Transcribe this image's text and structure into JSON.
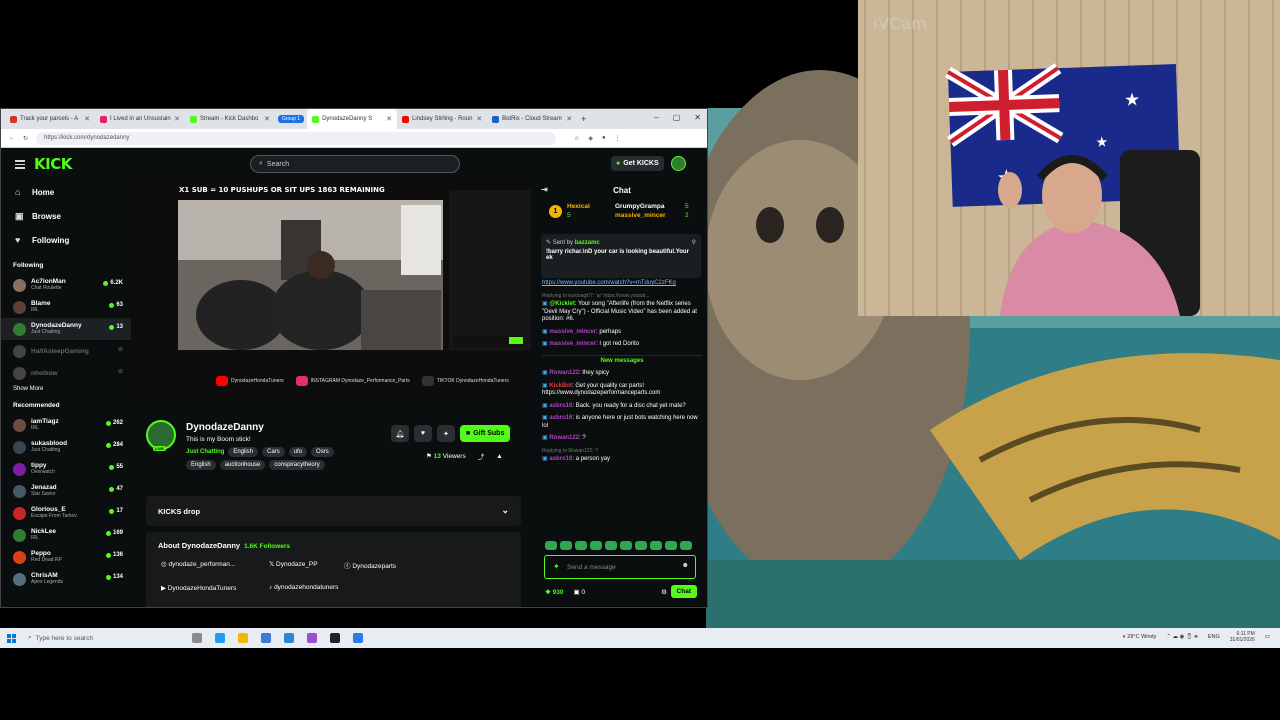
{
  "overlay": {
    "watermark": "iVCam"
  },
  "browser": {
    "tabs": [
      {
        "label": "Track your parcels - A",
        "color": "#d93025"
      },
      {
        "label": "I Lived in an Unsustain",
        "color": "#e91e63"
      },
      {
        "label": "Stream - Kick Dashbo",
        "color": "#53fc18"
      },
      {
        "label": "DynodazeDanny S",
        "color": "#53fc18",
        "active": true
      },
      {
        "label": "Lindsey Stirling - Roun",
        "color": "#ff0000"
      },
      {
        "label": "BotRix - Cloud Stream",
        "color": "#1565c0"
      }
    ],
    "group_label": "Group 1",
    "url": "https://kick.com/dynodazedanny",
    "addr_icons": [
      "↺",
      "☆",
      "⋮"
    ]
  },
  "kick": {
    "logo": "KICK",
    "search_placeholder": "Search",
    "get_kicks": "Get KICKS",
    "nav": [
      {
        "label": "Home",
        "icon": "home-icon",
        "glyph": "⌂"
      },
      {
        "label": "Browse",
        "icon": "browse-icon",
        "glyph": "▣"
      },
      {
        "label": "Following",
        "icon": "heart-icon",
        "glyph": "♥"
      }
    ],
    "following_label": "Following",
    "following": [
      {
        "name": "Ac7ionMan",
        "cat": "Chat Roulette",
        "viewers": "6.2K",
        "color": "#8d6e63"
      },
      {
        "name": "Blame",
        "cat": "IRL",
        "viewers": "63",
        "color": "#5d4037"
      },
      {
        "name": "DynodazeDanny",
        "cat": "Just Chatting",
        "viewers": "13",
        "color": "#2e7d32",
        "active": true
      },
      {
        "name": "HalfAsleepGaming",
        "cat": "",
        "viewers": "",
        "color": "#444",
        "off": true
      },
      {
        "name": "nhotkow",
        "cat": "",
        "viewers": "",
        "color": "#444",
        "off": true
      }
    ],
    "show_more": "Show More",
    "recommended_label": "Recommended",
    "recommended": [
      {
        "name": "iamTiagz",
        "cat": "IRL",
        "viewers": "262",
        "color": "#6d4c41"
      },
      {
        "name": "sukasblood",
        "cat": "Just Chatting",
        "viewers": "284",
        "color": "#37474f"
      },
      {
        "name": "tippy",
        "cat": "Overwatch",
        "viewers": "55",
        "color": "#7b1fa2"
      },
      {
        "name": "Jenazad",
        "cat": "Star Savior",
        "viewers": "47",
        "color": "#455a64"
      },
      {
        "name": "Glorious_E",
        "cat": "Escape From Tarkov",
        "viewers": "17",
        "color": "#c62828"
      },
      {
        "name": "NickLee",
        "cat": "IRL",
        "viewers": "169",
        "color": "#2e7d32"
      },
      {
        "name": "Peppo",
        "cat": "Red Dead RP",
        "viewers": "136",
        "color": "#d84315"
      },
      {
        "name": "ChrisAM",
        "cat": "Apex Legends",
        "viewers": "134",
        "color": "#546e7a"
      }
    ],
    "player": {
      "banner": "X1 SUB = 10 PUSHUPS OR SIT UPS 1863 REMAINING",
      "socials": [
        {
          "label": "DynodazeHondaTuners",
          "color": "#ff0000"
        },
        {
          "label": "INSTAGRAM Dynodaze_Performance_Parts",
          "color": "#e1306c"
        },
        {
          "label": "TIKTOK DynodazeHondaTuners",
          "color": "#111"
        }
      ]
    },
    "channel": {
      "name": "DynodazeDanny",
      "live": "LIVE",
      "title": "This is my Boom stick!",
      "category": "Just Chatting",
      "tags": [
        "English",
        "Cars",
        "ufo",
        "Osrs"
      ],
      "tags2": [
        "English",
        "auctionhouse",
        "conspiracytheory"
      ],
      "gift_subs": "Gift Subs",
      "viewers": "13",
      "viewers_label": "Viewers"
    },
    "drop": "KICKS drop",
    "about": {
      "title": "About DynodazeDanny",
      "followers": "1.6K Followers",
      "links": [
        "dynodaze_performan...",
        "Dynodaze_PP",
        "Dynodazeparts",
        "DynodazeHondaTuners",
        "dynodazehondatuners"
      ]
    }
  },
  "chat": {
    "title": "Chat",
    "top_gifters": [
      {
        "rank": "1",
        "name": "Hexical",
        "count": "5"
      },
      {
        "name": "GrumpyGrampa",
        "count": "5"
      },
      {
        "name": "massive_mincer",
        "count": "2"
      }
    ],
    "pinned_by_label": "Sent by",
    "pinned_by": "bazzamc",
    "pinned_text": "!barry richar.\\nD your car is looking beautiful.Your ek",
    "messages": [
      {
        "user": "",
        "text": "https://www.youtube.com/watch?v=mTduyC2zFKg",
        "link": true
      },
      {
        "reply": "Replying to kurosagi07: 'ar' https://www.youtub..."
      },
      {
        "user": "@Kicklet",
        "color": "#53fc18",
        "text": ": Your song \"Afterlife (from the Netflix series \"Devil May Cry\") - Official Music Video\" has been added at position: #6."
      },
      {
        "user": "massive_mincer",
        "color": "#ab47bc",
        "text": ": perhaps"
      },
      {
        "user": "massive_mincer",
        "color": "#ab47bc",
        "text": ": I got red Dorito"
      }
    ],
    "new_messages": "New messages",
    "messages2": [
      {
        "user": "Rowan122",
        "color": "#ab47bc",
        "text": ": they spicy"
      },
      {
        "user": "KickBot",
        "color": "#e53935",
        "text": ": Get your quality car parts! https://www.dynodazeperformanceparts.com"
      },
      {
        "user": "asbro16",
        "color": "#ab47bc",
        "text": ": Back. you ready for a disc chat yet mate?"
      },
      {
        "user": "asbro16",
        "color": "#ab47bc",
        "text": ": is anyone here or just bots watching here now lol"
      },
      {
        "user": "Rowan122",
        "color": "#ab47bc",
        "text": ": ?"
      },
      {
        "reply": "Replying to Rowan122: ?"
      },
      {
        "user": "asbro16",
        "color": "#ab47bc",
        "text": ": a person yay"
      }
    ],
    "input_placeholder": "Send a message",
    "points": "930",
    "count": "0",
    "send": "Chat"
  },
  "taskbar": {
    "search_placeholder": "Type here to search",
    "weather": "28°C Windy",
    "lang": "ENG",
    "time": "6:11 PM",
    "date": "31/01/2026"
  }
}
